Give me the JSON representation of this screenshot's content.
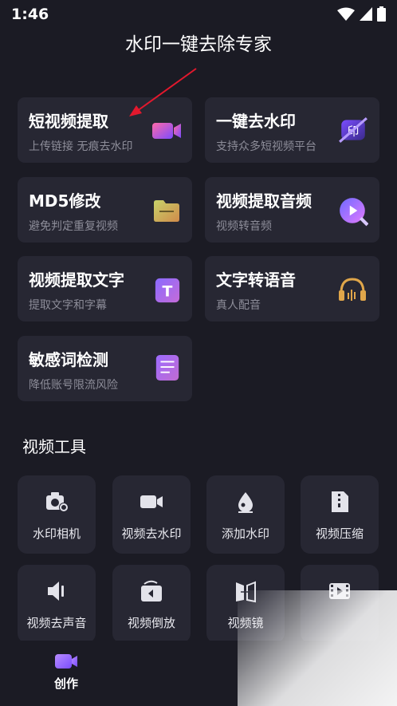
{
  "status": {
    "time": "1:46"
  },
  "page_title": "水印一键去除专家",
  "feature_cards": [
    {
      "title": "短视频提取",
      "subtitle": "上传链接 无痕去水印",
      "icon": "video-camera-icon"
    },
    {
      "title": "一键去水印",
      "subtitle": "支持众多短视频平台",
      "icon": "watermark-remove-icon"
    },
    {
      "title": "MD5修改",
      "subtitle": "避免判定重复视频",
      "icon": "folder-icon"
    },
    {
      "title": "视频提取音频",
      "subtitle": "视频转音频",
      "icon": "audio-disc-icon"
    },
    {
      "title": "视频提取文字",
      "subtitle": "提取文字和字幕",
      "icon": "text-t-icon"
    },
    {
      "title": "文字转语音",
      "subtitle": "真人配音",
      "icon": "headphones-icon"
    },
    {
      "title": "敏感词检测",
      "subtitle": "降低账号限流风险",
      "icon": "document-list-icon"
    }
  ],
  "section_title": "视频工具",
  "tools": [
    {
      "label": "水印相机",
      "icon": "camera-icon"
    },
    {
      "label": "视频去水印",
      "icon": "video-icon"
    },
    {
      "label": "添加水印",
      "icon": "drop-icon"
    },
    {
      "label": "视频压缩",
      "icon": "zip-icon"
    },
    {
      "label": "视频去声音",
      "icon": "mute-icon"
    },
    {
      "label": "视频倒放",
      "icon": "reverse-icon"
    },
    {
      "label": "视频镜",
      "icon": "mirror-icon"
    },
    {
      "label": "",
      "icon": "film-icon"
    }
  ],
  "tab_bar": {
    "active_label": "创作"
  },
  "colors": {
    "background": "#1b1b24",
    "card": "#272733",
    "accent": "#a46bff",
    "subtitle": "#8d8d99",
    "arrow": "#e3182d"
  }
}
